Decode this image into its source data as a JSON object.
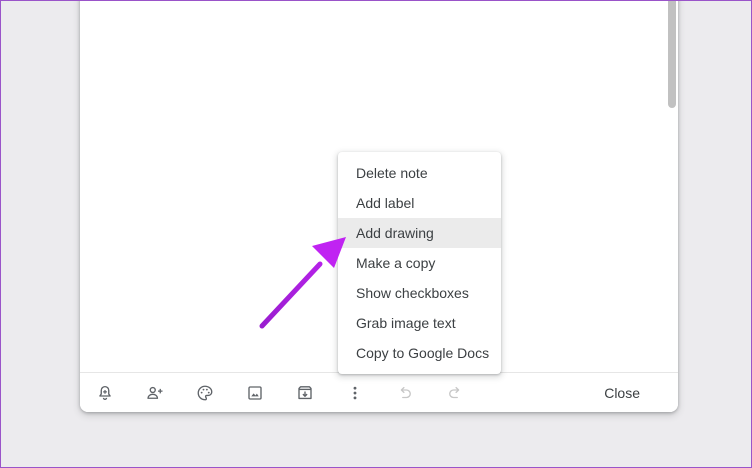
{
  "menu": {
    "items": [
      {
        "label": "Delete note"
      },
      {
        "label": "Add label"
      },
      {
        "label": "Add drawing"
      },
      {
        "label": "Make a copy"
      },
      {
        "label": "Show checkboxes"
      },
      {
        "label": "Grab image text"
      },
      {
        "label": "Copy to Google Docs"
      }
    ],
    "highlighted_item": "Add drawing"
  },
  "toolbar": {
    "icons": [
      "remind-me-icon",
      "collaborator-icon",
      "palette-icon",
      "add-image-icon",
      "archive-icon",
      "more-icon",
      "undo-icon",
      "redo-icon"
    ],
    "close_label": "Close"
  },
  "colors": {
    "annotation_arrow": "#b11fe8",
    "highlight": "#ebebeb",
    "frame_border": "#9a54c9"
  }
}
